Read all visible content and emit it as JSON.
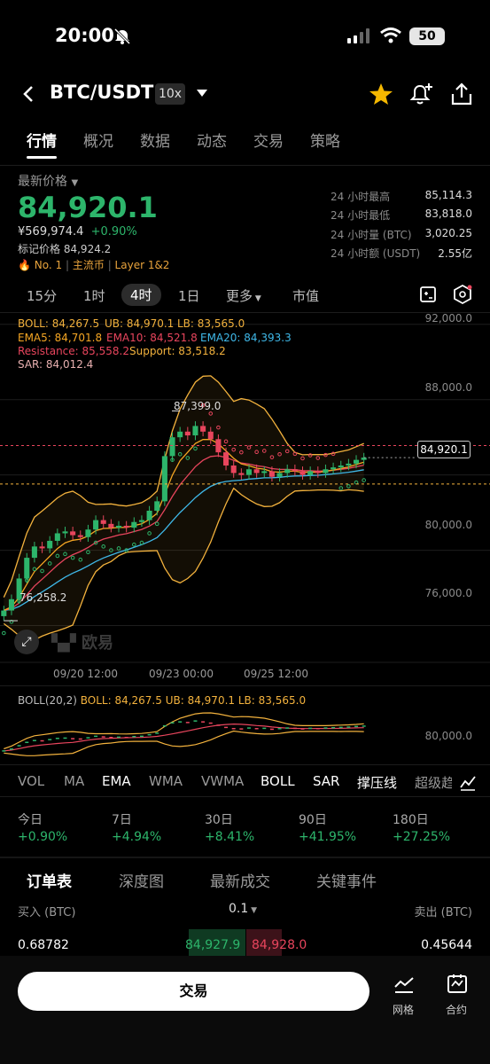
{
  "status": {
    "time": "20:00",
    "battery": "50"
  },
  "header": {
    "pair": "BTC/USDT",
    "leverage": "10x"
  },
  "tabs": [
    "行情",
    "概况",
    "数据",
    "动态",
    "交易",
    "策略"
  ],
  "price_block": {
    "label": "最新价格",
    "price": "84,920.1",
    "cny": "¥569,974.4",
    "change": "+0.90%",
    "mark_label": "标记价格",
    "mark_value": "84,924.2",
    "tags": [
      "No. 1",
      "主流币",
      "Layer 1&2"
    ]
  },
  "stats": [
    {
      "label": "24 小时最高",
      "value": "85,114.3"
    },
    {
      "label": "24 小时最低",
      "value": "83,818.0"
    },
    {
      "label": "24 小时量 (BTC)",
      "value": "3,020.25"
    },
    {
      "label": "24 小时额 (USDT)",
      "value": "2.55亿"
    }
  ],
  "timeframes": {
    "items": [
      "15分",
      "1时",
      "4时",
      "1日",
      "更多",
      "市值"
    ],
    "active": "4时"
  },
  "indicators": {
    "boll": "BOLL: 84,267.5",
    "ub": "UB: 84,970.1",
    "lb": "LB: 83,565.0",
    "ema5": "EMA5: 84,701.8",
    "ema10": "EMA10: 84,521.8",
    "ema20": "EMA20: 84,393.3",
    "resistance": "Resistance: 85,558.2",
    "support": "Support: 83,518.2",
    "sar": "SAR: 84,012.4"
  },
  "colors": {
    "up": "#2db56b",
    "down": "#e8455d",
    "boll": "#f3b23d",
    "ema5": "#f5a623",
    "ema10": "#e8455d",
    "ema20": "#3fb8e8"
  },
  "chart_data": {
    "type": "candlestick",
    "y_axis_ticks": [
      "92,000.0",
      "88,000.0",
      "84,000.0",
      "80,000.0",
      "76,000.0"
    ],
    "ylim": [
      74000,
      92600
    ],
    "x_ticks": [
      "09/20 12:00",
      "09/23 00:00",
      "09/25 12:00"
    ],
    "high_label": "87,399.0",
    "low_label": "76,258.2",
    "last_price": "84,920.1",
    "resistance": 85558.2,
    "support": 83518.2,
    "closes": [
      76800,
      77400,
      78500,
      79600,
      80200,
      80100,
      80500,
      80900,
      81000,
      80800,
      80700,
      81100,
      81600,
      81400,
      81200,
      81300,
      81200,
      81500,
      81600,
      82100,
      82600,
      85000,
      86000,
      86300,
      86100,
      86600,
      86300,
      85900,
      85200,
      84500,
      84100,
      84000,
      84300,
      84100,
      84200,
      83900,
      84100,
      84300,
      84200,
      84000,
      84200,
      84100,
      84300,
      84400,
      84500,
      84600,
      84800,
      84920
    ]
  },
  "watermark": "欧易",
  "sub_chart": {
    "label": "BOLL(20,2)",
    "boll": "BOLL: 84,267.5",
    "ub": "UB: 84,970.1",
    "lb": "LB: 83,565.0",
    "tick": "80,000.0"
  },
  "indicator_tabs": [
    "VOL",
    "MA",
    "EMA",
    "WMA",
    "VWMA",
    "BOLL",
    "SAR",
    "撑压线",
    "超级趋"
  ],
  "performance": [
    {
      "period": "今日",
      "value": "+0.90%"
    },
    {
      "period": "7日",
      "value": "+4.94%"
    },
    {
      "period": "30日",
      "value": "+8.41%"
    },
    {
      "period": "90日",
      "value": "+41.95%"
    },
    {
      "period": "180日",
      "value": "+27.25%"
    }
  ],
  "orderbook": {
    "tabs": [
      "订单表",
      "深度图",
      "最新成交",
      "关键事件"
    ],
    "buy_header": "买入 (BTC)",
    "precision": "0.1",
    "sell_header": "卖出 (BTC)",
    "row": {
      "buy_qty": "0.68782",
      "bid": "84,927.9",
      "ask": "84,928.0",
      "sell_qty": "0.45644"
    }
  },
  "bottom": {
    "trade": "交易",
    "grid": "网格",
    "contract": "合约"
  }
}
